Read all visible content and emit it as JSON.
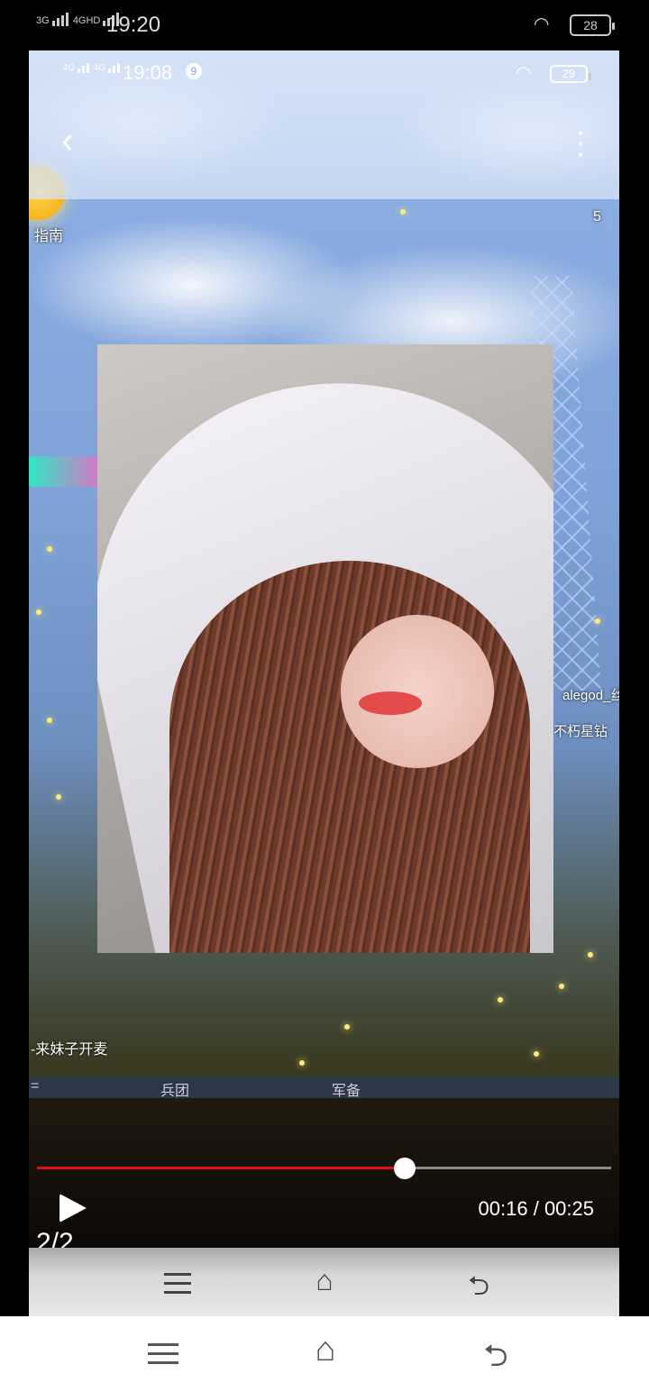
{
  "outer_status": {
    "signal_1": "3G",
    "signal_2": "4GHD",
    "time": "19:20",
    "battery": "28"
  },
  "inner_status": {
    "signal_1": "4G",
    "signal_2": "4G",
    "time": "19:08",
    "notif": "9",
    "battery": "29"
  },
  "game": {
    "left_label": "指南",
    "right_label": "5",
    "comment_name": "alegod_丝",
    "comment_text": "不朽星钻",
    "bottom_label": "-来妹子开麦",
    "tabs": [
      "=",
      "兵团",
      "军备"
    ]
  },
  "video": {
    "progress": 0.64,
    "timecode": "00:16 / 00:25",
    "page_counter": "2/2"
  },
  "icons": [
    "back-icon",
    "more-icon",
    "play-icon",
    "menu-icon",
    "home-icon",
    "return-icon",
    "wifi-icon",
    "battery-icon"
  ]
}
